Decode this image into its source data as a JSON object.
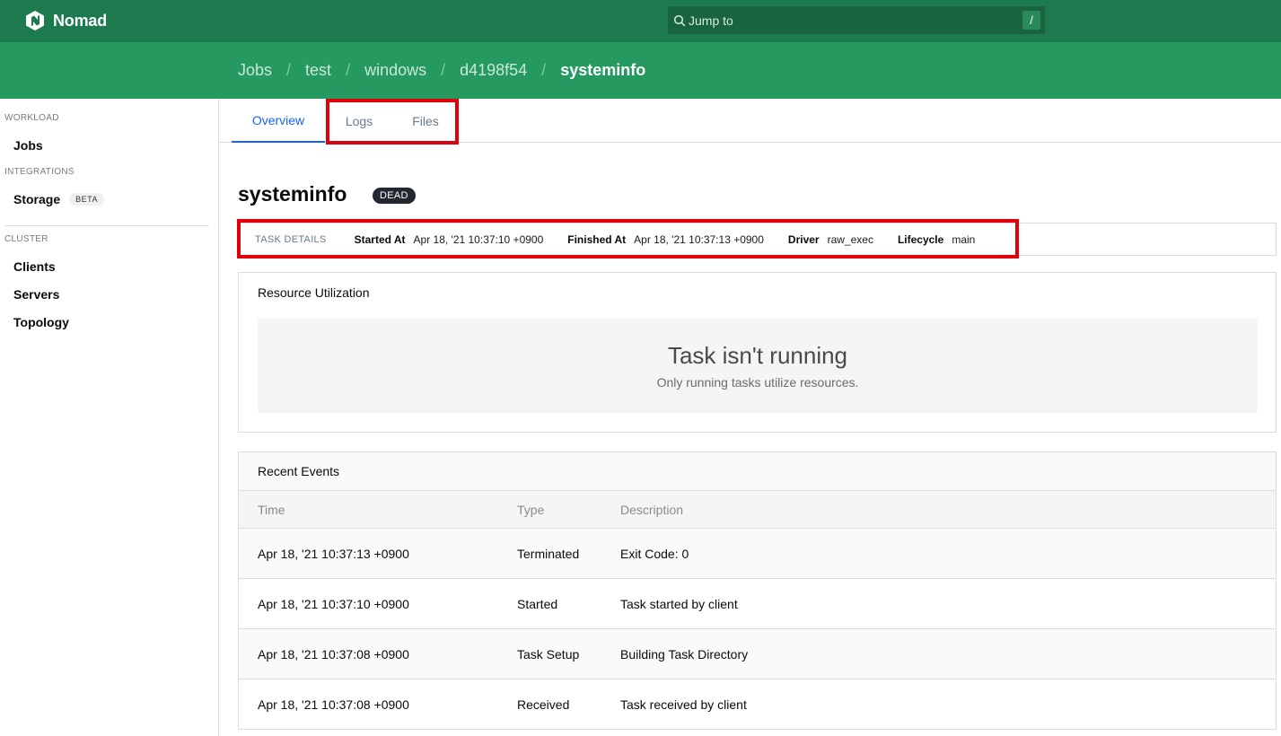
{
  "topbar": {
    "brand": "Nomad",
    "search_placeholder": "Jump to",
    "search_key": "/"
  },
  "breadcrumb": [
    "Jobs",
    "test",
    "windows",
    "d4198f54",
    "systeminfo"
  ],
  "sidebar": {
    "sections": [
      {
        "label": "WORKLOAD",
        "items": [
          {
            "label": "Jobs"
          }
        ]
      },
      {
        "label": "INTEGRATIONS",
        "items": [
          {
            "label": "Storage",
            "badge": "BETA"
          }
        ]
      },
      {
        "label": "CLUSTER",
        "items": [
          {
            "label": "Clients"
          },
          {
            "label": "Servers"
          },
          {
            "label": "Topology"
          }
        ]
      }
    ]
  },
  "tabs": [
    {
      "label": "Overview",
      "active": true
    },
    {
      "label": "Logs"
    },
    {
      "label": "Files"
    }
  ],
  "task": {
    "name": "systeminfo",
    "status": "DEAD",
    "details_label": "TASK DETAILS",
    "details": [
      {
        "key": "Started At",
        "value": "Apr 18, '21 10:37:10 +0900"
      },
      {
        "key": "Finished At",
        "value": "Apr 18, '21 10:37:13 +0900"
      },
      {
        "key": "Driver",
        "value": "raw_exec"
      },
      {
        "key": "Lifecycle",
        "value": "main"
      }
    ]
  },
  "resources": {
    "title": "Resource Utilization",
    "empty_heading": "Task isn't running",
    "empty_message": "Only running tasks utilize resources."
  },
  "events": {
    "title": "Recent Events",
    "columns": [
      "Time",
      "Type",
      "Description"
    ],
    "rows": [
      [
        "Apr 18, '21 10:37:13 +0900",
        "Terminated",
        "Exit Code: 0"
      ],
      [
        "Apr 18, '21 10:37:10 +0900",
        "Started",
        "Task started by client"
      ],
      [
        "Apr 18, '21 10:37:08 +0900",
        "Task Setup",
        "Building Task Directory"
      ],
      [
        "Apr 18, '21 10:37:08 +0900",
        "Received",
        "Task received by client"
      ]
    ]
  },
  "colors": {
    "topbar": "#1d7a4e",
    "crumbbar": "#25995f",
    "accent": "#1563ff",
    "highlight": "#e0000b"
  }
}
